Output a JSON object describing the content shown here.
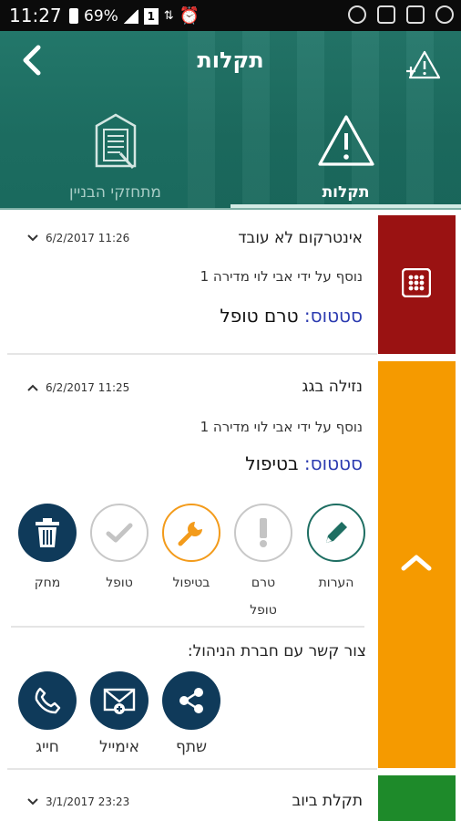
{
  "status_bar": {
    "time": "11:27",
    "battery": "69%",
    "sim": "1"
  },
  "header": {
    "title": "תקלות",
    "tabs": [
      {
        "label": "תקלות",
        "icon": "warning-icon",
        "active": true
      },
      {
        "label": "מתחזקי הבניין",
        "icon": "building-checklist-icon",
        "active": false
      }
    ]
  },
  "colors": {
    "header": "#1c6c60",
    "status_new": "#9a1212",
    "status_in_progress": "#f59a00",
    "status_done": "#1e8a2a",
    "status_key": "#2c3bb0",
    "action_dark": "#0f3a5a",
    "action_orange": "#f39b1b"
  },
  "faults": [
    {
      "title": "אינטרקום לא עובד",
      "date": "6/2/2017 11:26",
      "added_by": "נוסף על ידי אבי לוי מדירה 1",
      "status_key": "סטטוס:",
      "status_value": "טרם טופל",
      "expanded": false,
      "side_icon": "keypad-icon"
    },
    {
      "title": "נזילה בגג",
      "date": "6/2/2017 11:25",
      "added_by": "נוסף על ידי אבי לוי מדירה 1",
      "status_key": "סטטוס:",
      "status_value": "בטיפול",
      "expanded": true,
      "side_icon": "chevron-up-icon",
      "actions": [
        {
          "label": "מחק",
          "icon": "trash-icon"
        },
        {
          "label": "טופל",
          "icon": "check-icon"
        },
        {
          "label": "בטיפול",
          "icon": "wrench-icon"
        },
        {
          "label": "טרם טופל",
          "icon": "exclamation-icon"
        },
        {
          "label": "הערות",
          "icon": "pencil-icon"
        }
      ],
      "contact_title": "צור קשר עם חברת הניהול:",
      "contacts": [
        {
          "label": "חייג",
          "icon": "phone-icon"
        },
        {
          "label": "אימייל",
          "icon": "email-icon"
        },
        {
          "label": "שתף",
          "icon": "share-icon"
        }
      ]
    },
    {
      "title": "תקלת ביוב",
      "date": "3/1/2017 23:23",
      "expanded": false
    }
  ]
}
